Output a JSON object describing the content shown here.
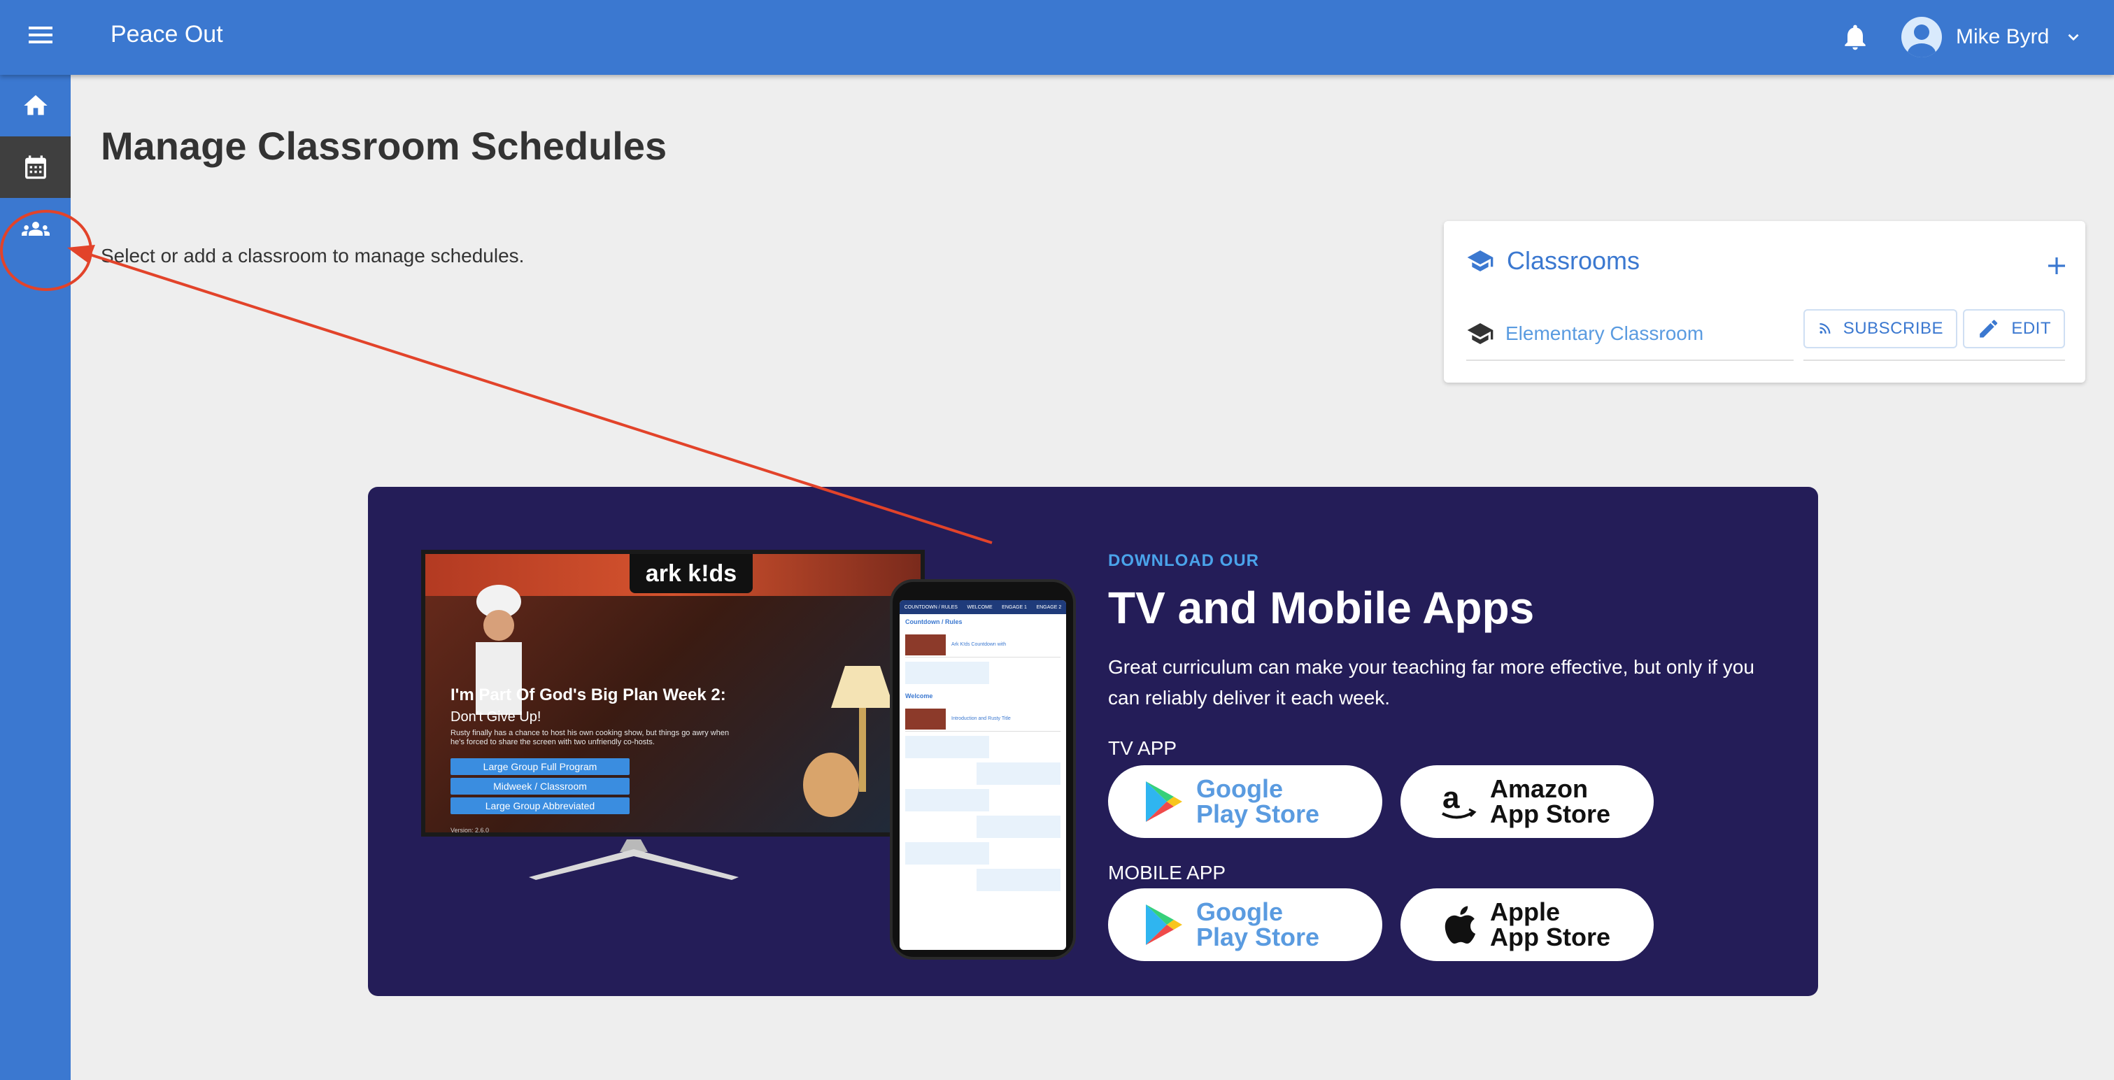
{
  "app": {
    "title": "Peace Out"
  },
  "user": {
    "name": "Mike Byrd"
  },
  "sidebar": {
    "items": [
      {
        "icon": "home-icon"
      },
      {
        "icon": "calendar-icon",
        "active": true
      },
      {
        "icon": "people-icon"
      }
    ]
  },
  "page": {
    "title": "Manage Classroom Schedules",
    "hint": "Select or add a classroom to manage schedules."
  },
  "classrooms": {
    "title": "Classrooms",
    "items": [
      {
        "name": "Elementary Classroom"
      }
    ],
    "subscribe_label": "SUBSCRIBE",
    "edit_label": "EDIT"
  },
  "promo": {
    "kicker": "DOWNLOAD OUR",
    "title": "TV and Mobile Apps",
    "description": "Great curriculum can make your teaching far more effective, but only if you can reliably deliver it each week.",
    "tv_app_label": "TV APP",
    "mobile_app_label": "MOBILE APP",
    "google_play_line1": "Google",
    "google_play_line2": "Play Store",
    "amazon_line1": "Amazon",
    "amazon_line2": "App Store",
    "apple_line1": "Apple",
    "apple_line2": "App Store",
    "tv_preview": {
      "logo": "ark k!ds",
      "heading": "I'm Part Of God's Big Plan Week 2:",
      "subheading": "Don't Give Up!",
      "description": "Rusty finally has a chance to host his own cooking show, but things go awry when he's forced to share the screen with two unfriendly co-hosts.",
      "buttons": [
        "Large Group Full Program",
        "Midweek / Classroom",
        "Large Group Abbreviated"
      ],
      "version": "Version: 2.6.0"
    },
    "phone_preview": {
      "tabs": [
        "COUNTDOWN / RULES",
        "WELCOME",
        "ENGAGE 1",
        "ENGAGE 2"
      ],
      "section1": "Countdown / Rules",
      "item1": "Ark K!ds Countdown with",
      "section2": "Welcome",
      "item2": "Introduction and Rusty Title"
    }
  },
  "colors": {
    "brand": "#3b78d0",
    "banner": "#241d58",
    "accent": "#4aa3ea",
    "annotation": "#e2432a"
  }
}
